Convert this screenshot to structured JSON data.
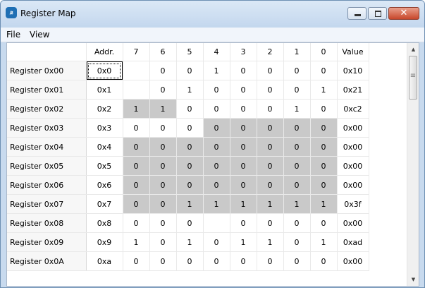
{
  "window": {
    "title": "Register Map",
    "icon": "app-icon",
    "icon_text": "ꭱ",
    "controls": [
      "minimize",
      "maximize",
      "close"
    ]
  },
  "menu": [
    "File",
    "View"
  ],
  "table": {
    "headers": [
      "",
      "Addr.",
      "7",
      "6",
      "5",
      "4",
      "3",
      "2",
      "1",
      "0",
      "Value"
    ],
    "rows": [
      {
        "label": "Register 0x00",
        "addr": "0x0",
        "bits": [
          "",
          "0",
          "0",
          "1",
          "0",
          "0",
          "0",
          "0"
        ],
        "value": "0x10",
        "gray": [
          false,
          false,
          false,
          false,
          false,
          false,
          false,
          false
        ],
        "focus_addr": true
      },
      {
        "label": "Register 0x01",
        "addr": "0x1",
        "bits": [
          "",
          "0",
          "1",
          "0",
          "0",
          "0",
          "0",
          "1"
        ],
        "value": "0x21",
        "gray": [
          false,
          false,
          false,
          false,
          false,
          false,
          false,
          false
        ]
      },
      {
        "label": "Register 0x02",
        "addr": "0x2",
        "bits": [
          "1",
          "1",
          "0",
          "0",
          "0",
          "0",
          "1",
          "0"
        ],
        "value": "0xc2",
        "gray": [
          true,
          true,
          false,
          false,
          false,
          false,
          false,
          false
        ]
      },
      {
        "label": "Register 0x03",
        "addr": "0x3",
        "bits": [
          "0",
          "0",
          "0",
          "0",
          "0",
          "0",
          "0",
          "0"
        ],
        "value": "0x00",
        "gray": [
          false,
          false,
          false,
          true,
          true,
          true,
          true,
          true
        ]
      },
      {
        "label": "Register 0x04",
        "addr": "0x4",
        "bits": [
          "0",
          "0",
          "0",
          "0",
          "0",
          "0",
          "0",
          "0"
        ],
        "value": "0x00",
        "gray": [
          true,
          true,
          true,
          true,
          true,
          true,
          true,
          true
        ]
      },
      {
        "label": "Register 0x05",
        "addr": "0x5",
        "bits": [
          "0",
          "0",
          "0",
          "0",
          "0",
          "0",
          "0",
          "0"
        ],
        "value": "0x00",
        "gray": [
          true,
          true,
          true,
          true,
          true,
          true,
          true,
          true
        ]
      },
      {
        "label": "Register 0x06",
        "addr": "0x6",
        "bits": [
          "0",
          "0",
          "0",
          "0",
          "0",
          "0",
          "0",
          "0"
        ],
        "value": "0x00",
        "gray": [
          true,
          true,
          true,
          true,
          true,
          true,
          true,
          true
        ]
      },
      {
        "label": "Register 0x07",
        "addr": "0x7",
        "bits": [
          "0",
          "0",
          "1",
          "1",
          "1",
          "1",
          "1",
          "1"
        ],
        "value": "0x3f",
        "gray": [
          true,
          true,
          true,
          true,
          true,
          true,
          true,
          true
        ]
      },
      {
        "label": "Register 0x08",
        "addr": "0x8",
        "bits": [
          "0",
          "0",
          "0",
          "",
          "0",
          "0",
          "0",
          "0"
        ],
        "value": "0x00",
        "gray": [
          false,
          false,
          false,
          false,
          false,
          false,
          false,
          false
        ]
      },
      {
        "label": "Register 0x09",
        "addr": "0x9",
        "bits": [
          "1",
          "0",
          "1",
          "0",
          "1",
          "1",
          "0",
          "1"
        ],
        "value": "0xad",
        "gray": [
          false,
          false,
          false,
          false,
          false,
          false,
          false,
          false
        ]
      },
      {
        "label": "Register 0x0A",
        "addr": "0xa",
        "bits": [
          "0",
          "0",
          "0",
          "0",
          "0",
          "0",
          "0",
          "0"
        ],
        "value": "0x00",
        "gray": [
          false,
          false,
          false,
          false,
          false,
          false,
          false,
          false
        ]
      }
    ]
  },
  "scrollbar": {
    "up_icon": "arrow-up-icon",
    "down_icon": "arrow-down-icon"
  },
  "colors": {
    "highlight": "#c9c9c9",
    "title_bar": "#c3d7ee",
    "close_button": "#c8472b"
  }
}
